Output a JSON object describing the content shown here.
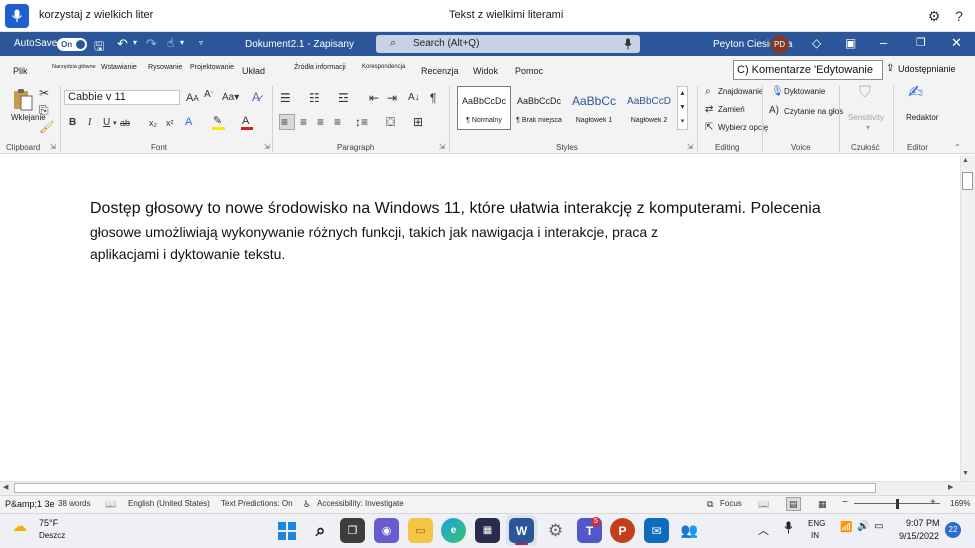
{
  "voice_bar": {
    "command_text": "korzystaj z wielkich liter",
    "center_title": "Tekst z wielkimi literami"
  },
  "title_bar": {
    "autosave_label": "AutoSave",
    "autosave_state": "On",
    "doc_title": "Dokument2.1 - Zapisany",
    "search_placeholder": "Search (Alt+Q)",
    "user_name": "Peyton Ciesielska",
    "user_initials": "PD"
  },
  "tabs": {
    "plik": "Plik",
    "narzedzia": "Narzędzia główne",
    "wstawianie": "Wstawianie",
    "rysowanie": "Rysowanie",
    "projektowanie": "Projektowanie",
    "uklad": "Układ",
    "zrodla": "Źródła informacji",
    "korespondencja": "Korespondencja",
    "recenzja": "Recenzja",
    "widok": "Widok",
    "pomoc": "Pomoc",
    "comments": "C) Komentarze 'Edytowanie",
    "share": "Udostępnianie"
  },
  "ribbon": {
    "paste_label": "Wklejanie",
    "clipboard_label": "Clipboard",
    "font_name": "Cabbie v 11",
    "font_label": "Font",
    "paragraph_label": "Paragraph",
    "styles_label": "Styles",
    "styles": [
      {
        "sample": "AaBbCcDc",
        "name": "¶ Normalny"
      },
      {
        "sample": "AaBbCcDc",
        "name": "¶ Brak miejsca"
      },
      {
        "sample": "AaBbCc",
        "name": "Nagłówek 1"
      },
      {
        "sample": "AaBbCcD",
        "name": "Nagłówek 2"
      }
    ],
    "find_label": "Znajdowanie",
    "replace_label": "Zamień",
    "select_label": "Wybierz opcję",
    "editing_label": "Editing",
    "dictate_label": "Dyktowanie",
    "read_aloud_label": "Czytanie na głos",
    "voice_label": "Voice",
    "sensitivity_label": "Sensitivity",
    "sensitivity_group": "Czułość",
    "editor_btn": "Redaktor",
    "editor_group": "Editor"
  },
  "document": {
    "line1": "Dostęp głosowy to nowe środowisko na Windows 11, które ułatwia interakcję z komputerami. Polecenia",
    "line2": "głosowe umożliwiają wykonywanie różnych funkcji, takich jak nawigacja i interakcje, praca z",
    "line3": "aplikacjami i dyktowanie tekstu."
  },
  "status_bar": {
    "page": "P&amp;1 3e",
    "words": "38 words",
    "language": "English (United States)",
    "predictions": "Text Predictions: On",
    "accessibility": "Accessibility: Investigate",
    "focus": "Focus",
    "zoom": "169%"
  },
  "taskbar": {
    "temperature": "75°F",
    "weather": "Deszcz",
    "lang_1": "ENG",
    "lang_2": "IN",
    "time": "9:07 PM",
    "date": "9/15/2022",
    "notifications": "22",
    "teams_badge": "5"
  },
  "colors": {
    "word_blue": "#2b579a",
    "accent": "#1f5fcc"
  }
}
